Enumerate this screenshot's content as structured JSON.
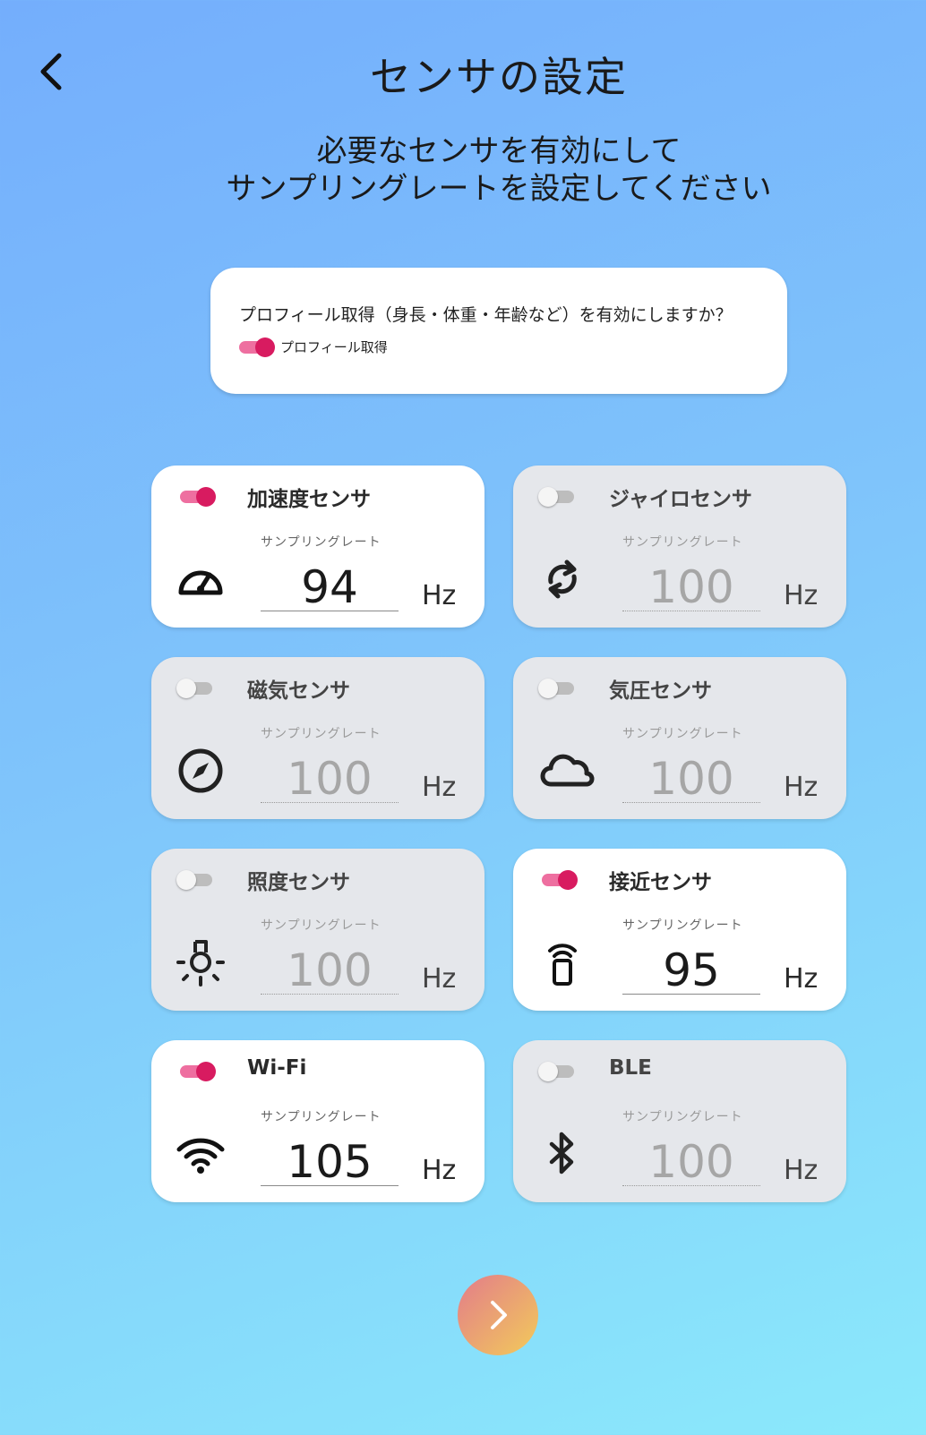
{
  "header": {
    "title": "センサの設定"
  },
  "subtitle": {
    "line1": "必要なセンサを有効にして",
    "line2": "サンプリングレートを設定してください"
  },
  "profile": {
    "question": "プロフィール取得（身長・体重・年齢など）を有効にしますか？",
    "toggle_label": "プロフィール取得",
    "enabled": true
  },
  "colors": {
    "toggle_on": "#d81b60",
    "enabled_card": "#ffffff",
    "disabled_card": "#e5e7eb"
  },
  "sensors": [
    {
      "name": "加速度センサ",
      "rate_label": "サンプリングレート",
      "value": "94",
      "unit": "Hz",
      "enabled": true,
      "icon": "speedometer-icon"
    },
    {
      "name": "ジャイロセンサ",
      "rate_label": "サンプリングレート",
      "value": "100",
      "unit": "Hz",
      "enabled": false,
      "icon": "rotate-icon"
    },
    {
      "name": "磁気センサ",
      "rate_label": "サンプリングレート",
      "value": "100",
      "unit": "Hz",
      "enabled": false,
      "icon": "compass-icon"
    },
    {
      "name": "気圧センサ",
      "rate_label": "サンプリングレート",
      "value": "100",
      "unit": "Hz",
      "enabled": false,
      "icon": "cloud-icon"
    },
    {
      "name": "照度センサ",
      "rate_label": "サンプリングレート",
      "value": "100",
      "unit": "Hz",
      "enabled": false,
      "icon": "light-bulb-icon"
    },
    {
      "name": "接近センサ",
      "rate_label": "サンプリングレート",
      "value": "95",
      "unit": "Hz",
      "enabled": true,
      "icon": "proximity-icon"
    },
    {
      "name": "Wi-Fi",
      "rate_label": "サンプリングレート",
      "value": "105",
      "unit": "Hz",
      "enabled": true,
      "icon": "wifi-icon"
    },
    {
      "name": "BLE",
      "rate_label": "サンプリングレート",
      "value": "100",
      "unit": "Hz",
      "enabled": false,
      "icon": "bluetooth-icon"
    }
  ],
  "next_button": {
    "icon": "chevron-right-icon"
  }
}
